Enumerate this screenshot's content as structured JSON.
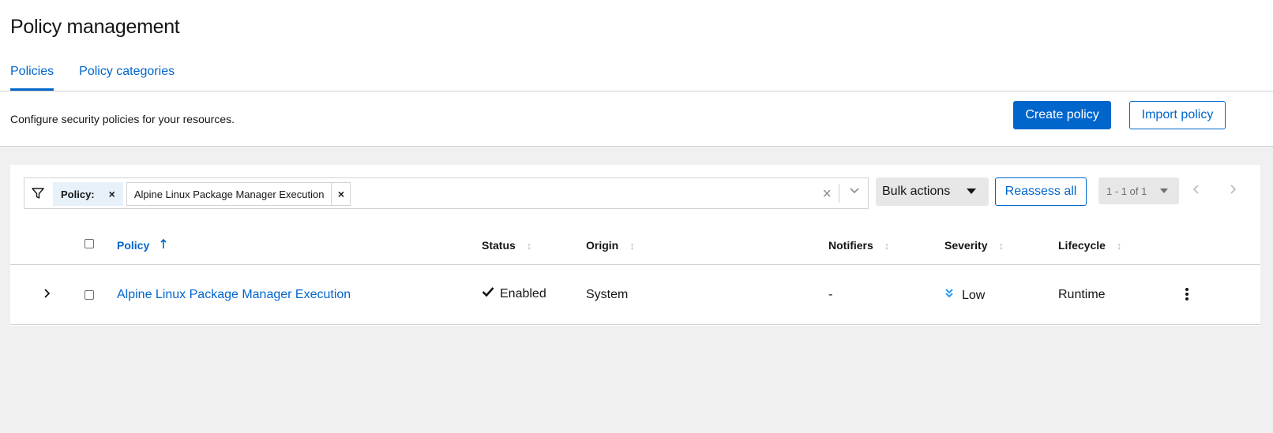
{
  "page": {
    "title": "Policy management",
    "tabs": [
      {
        "label": "Policies",
        "active": true
      },
      {
        "label": "Policy categories",
        "active": false
      }
    ]
  },
  "description": {
    "text": "Configure security policies for your resources.",
    "create_label": "Create policy",
    "import_label": "Import policy"
  },
  "toolbar": {
    "filter_category": "Policy:",
    "filter_value": "Alpine Linux Package Manager Execution",
    "bulk_actions_label": "Bulk actions",
    "reassess_label": "Reassess all",
    "pagination": "1 - 1 of 1"
  },
  "table": {
    "columns": [
      "Policy",
      "Status",
      "Origin",
      "Notifiers",
      "Severity",
      "Lifecycle"
    ],
    "sorted_by": "Policy",
    "rows": [
      {
        "policy": "Alpine Linux Package Manager Execution",
        "status": "Enabled",
        "origin": "System",
        "notifiers": "-",
        "severity": "Low",
        "lifecycle": "Runtime"
      }
    ]
  },
  "colors": {
    "accent": "#0066cc",
    "background": "#f0f0f0",
    "chip_bg": "#e7f1fa"
  },
  "icons": [
    "filter-icon",
    "close-icon",
    "clear-icon",
    "chevron-down-icon",
    "caret-down-icon",
    "chevron-left-icon",
    "chevron-right-icon",
    "sort-ascending-icon",
    "sort-icon",
    "check-icon",
    "angle-double-down-icon",
    "kebab-icon"
  ]
}
